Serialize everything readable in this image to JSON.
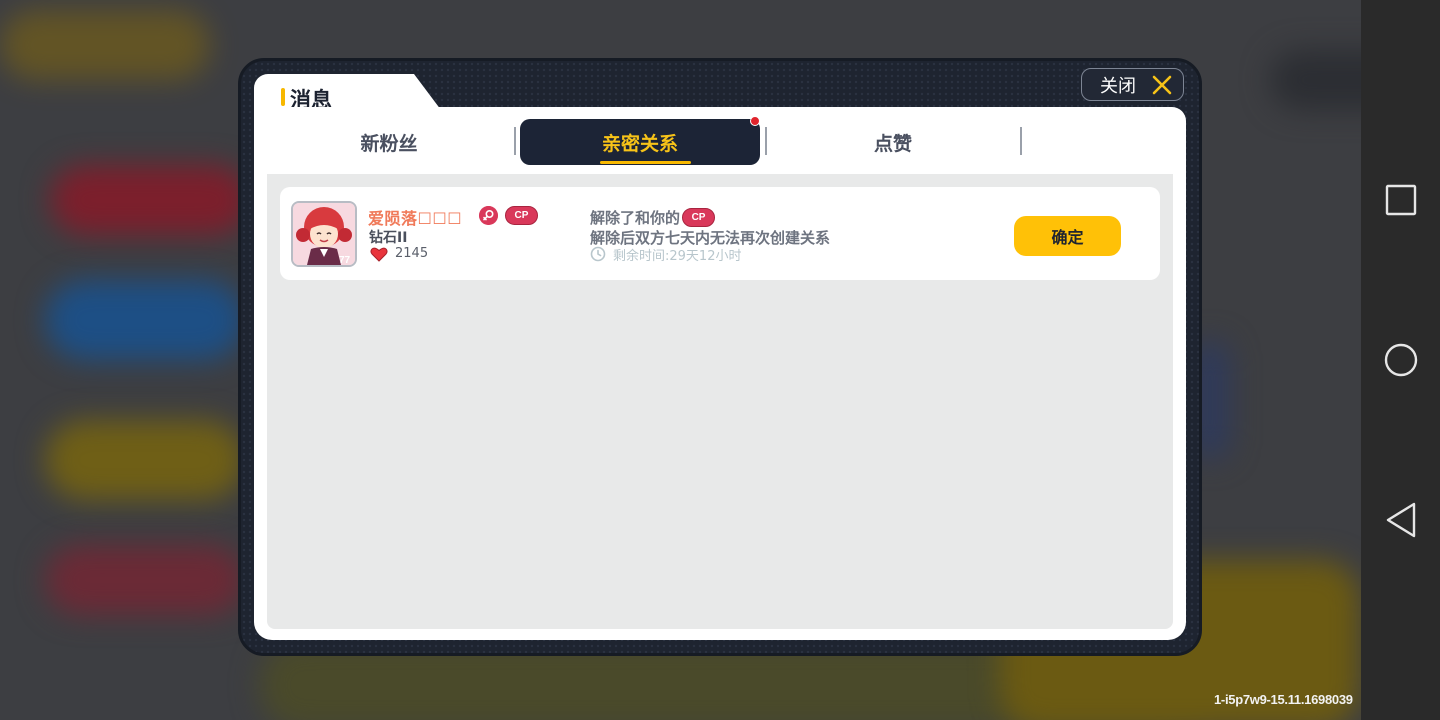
{
  "dialog": {
    "title": "消息",
    "close_label": "关闭"
  },
  "tabs": [
    {
      "label": "新粉丝",
      "active": false
    },
    {
      "label": "亲密关系",
      "active": true,
      "has_notification": true
    },
    {
      "label": "点赞",
      "active": false
    }
  ],
  "messages": [
    {
      "username": "爱陨落☐☐☐",
      "gender_icon": "female-icon",
      "relation_badge": "CP",
      "rank": "钻石II",
      "hearts": "2145",
      "text_line1": "解除了和你的",
      "text_badge": "CP",
      "text_line2": "解除后双方七天内无法再次创建关系",
      "remaining": "剩余时间:29天12小时",
      "confirm_label": "确定"
    }
  ],
  "build_id": "1-i5p7w9-15.11.1698039",
  "colors": {
    "accent_yellow": "#ffc107",
    "tab_dark": "#1c2436",
    "username": "#f07a5a",
    "cp_badge": "#d9385a"
  }
}
